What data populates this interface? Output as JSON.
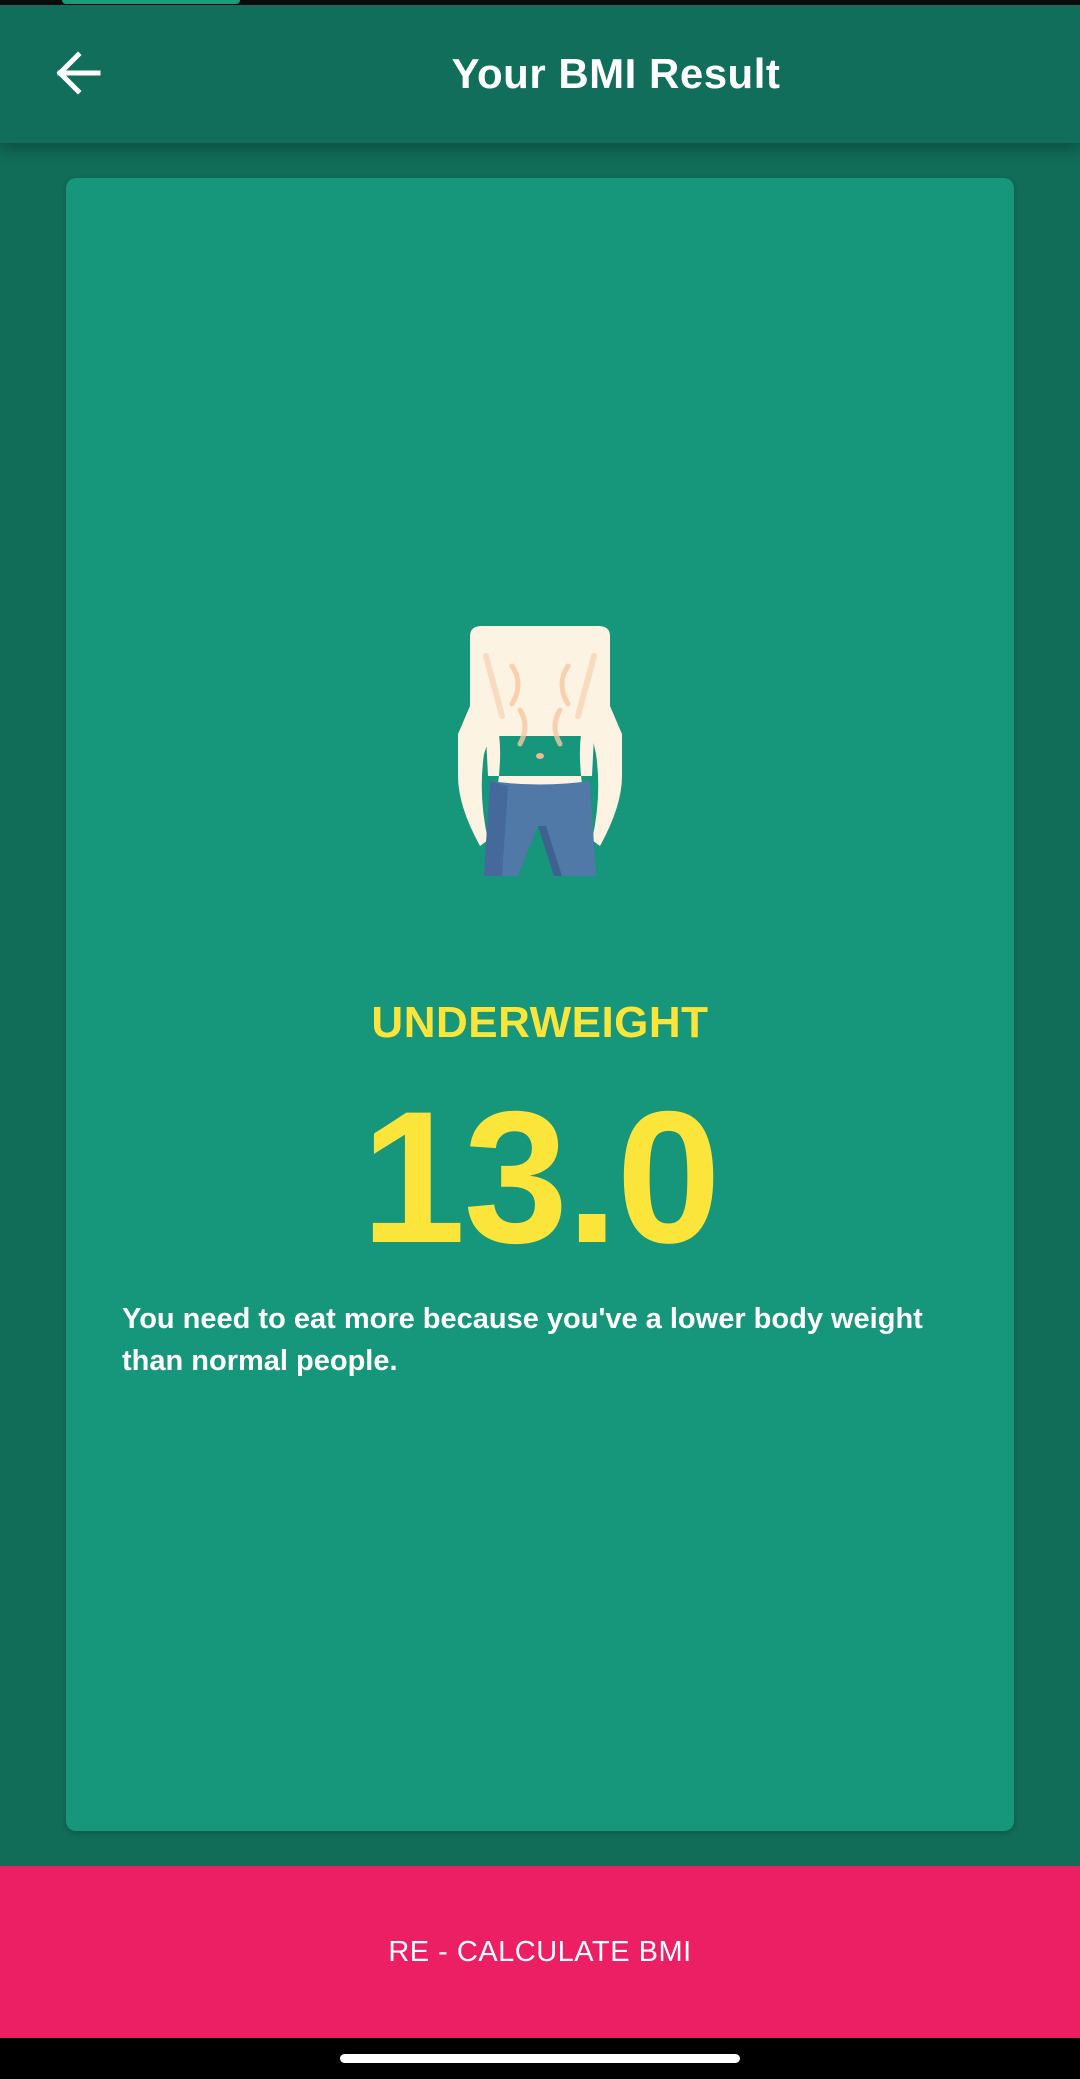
{
  "app_bar": {
    "title": "Your BMI Result",
    "back_icon": "arrow-left-icon"
  },
  "result": {
    "illustration_icon": "thin-body-icon",
    "status": "UNDERWEIGHT",
    "value": "13.0",
    "advice": "You need to eat more because you've a lower body weight than normal people."
  },
  "actions": {
    "recalculate_label": "RE - CALCULATE BMI"
  },
  "colors": {
    "background": "#116c58",
    "app_bar": "#106e5a",
    "card": "#16967a",
    "accent_yellow": "#fbe53b",
    "button_pink": "#ec1f65",
    "text_white": "#ffffff"
  }
}
